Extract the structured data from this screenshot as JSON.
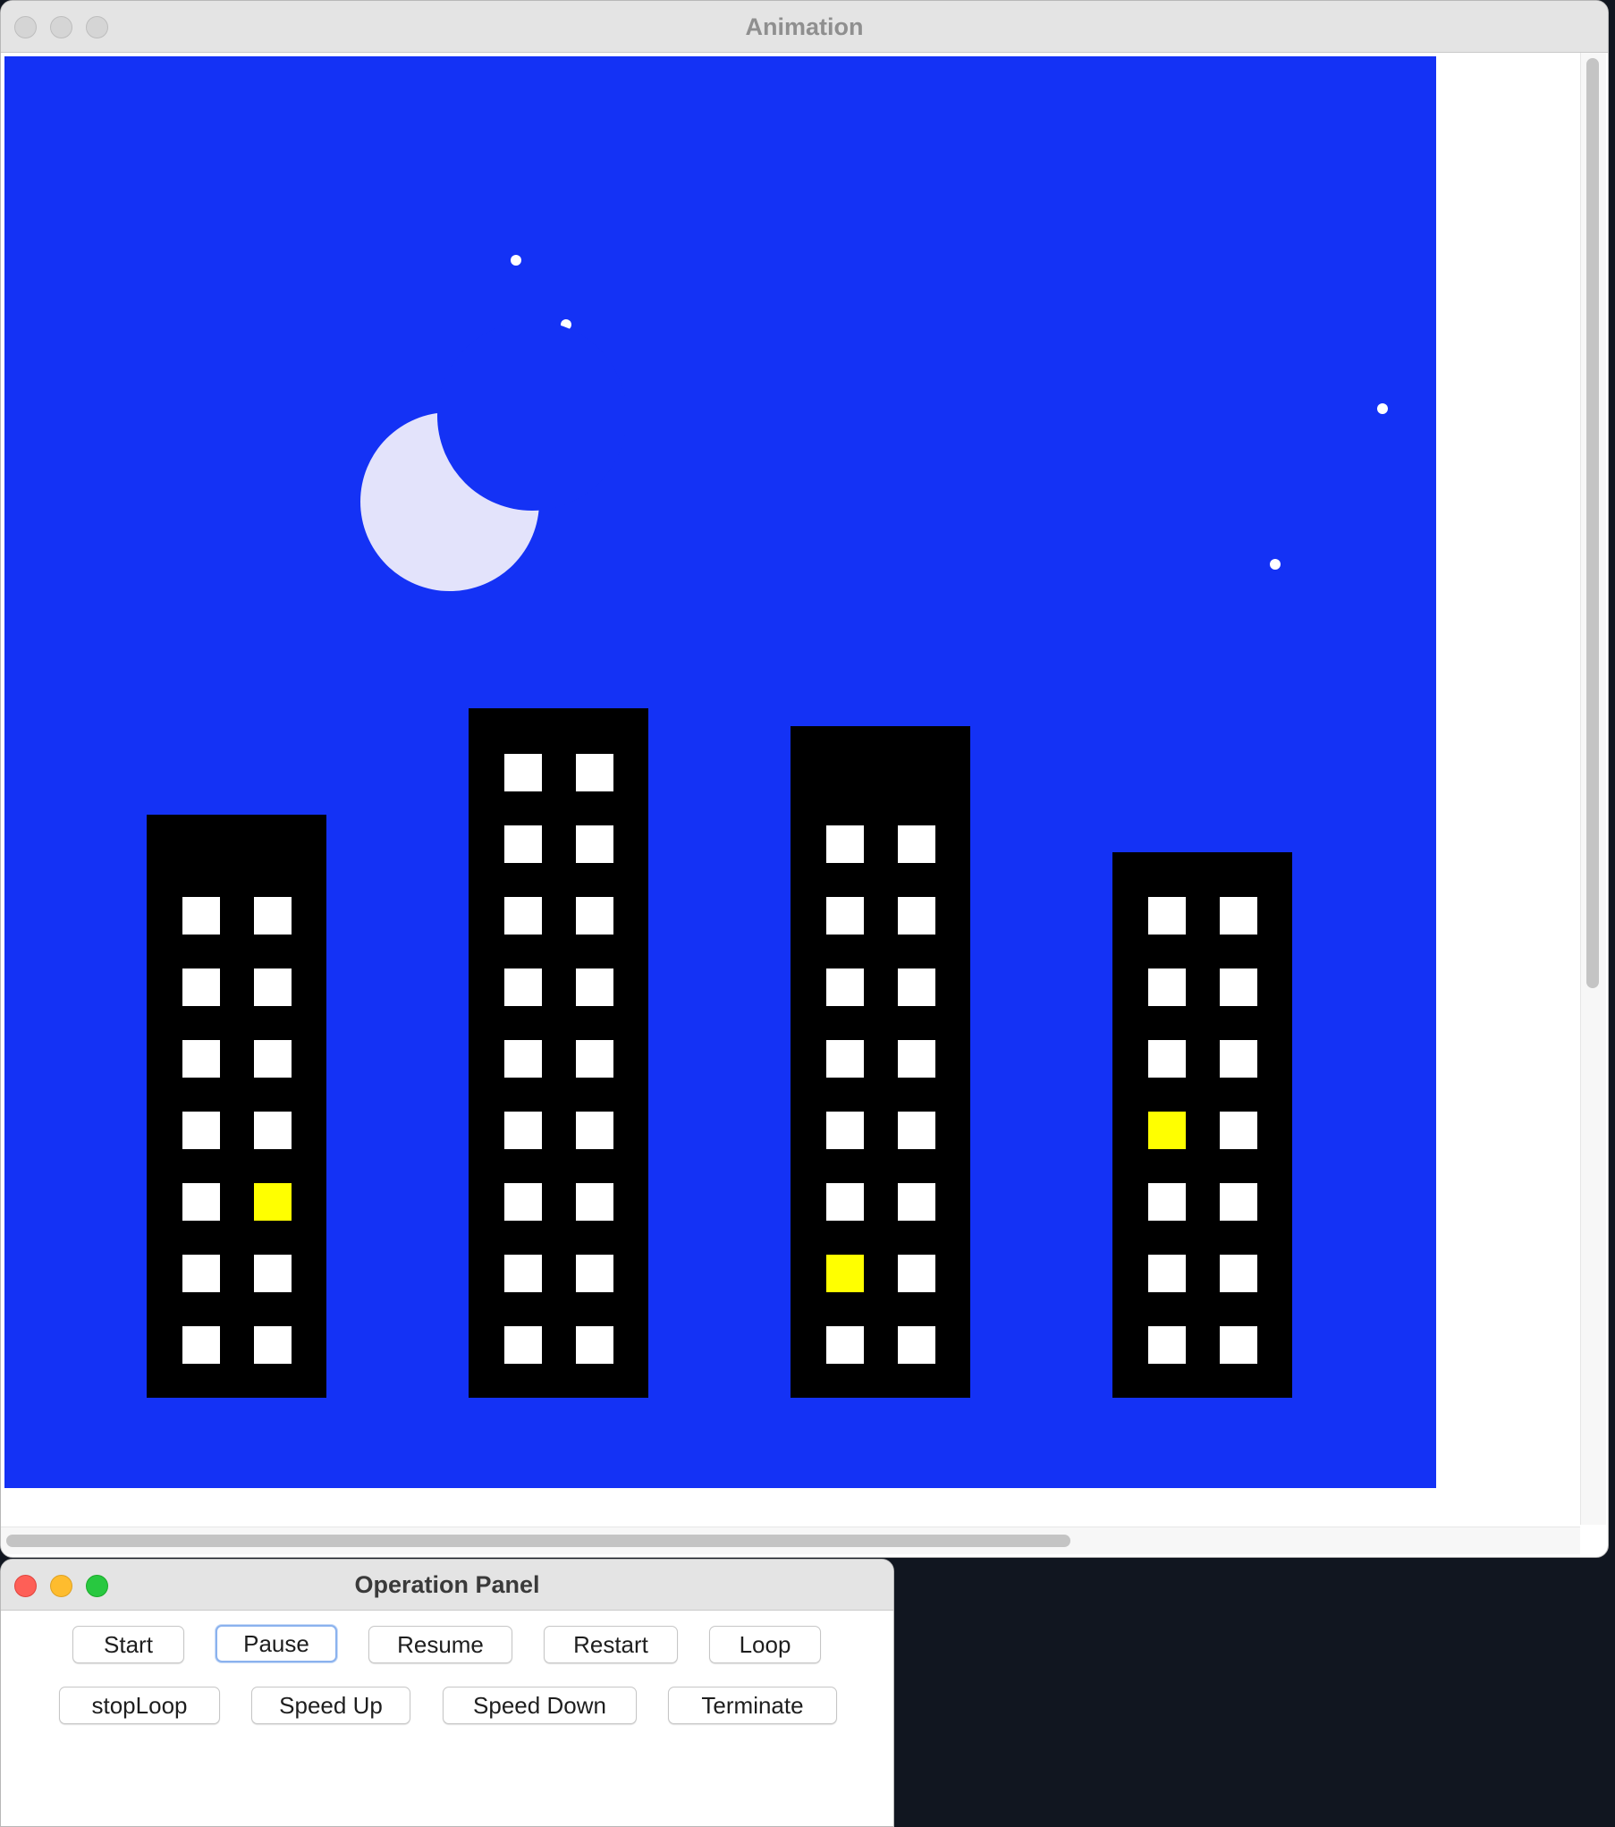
{
  "animation_window": {
    "title": "Animation",
    "scene": {
      "sky_color": "#1432f5",
      "moon_color": "#e3e3fb",
      "building_color": "#000000",
      "window_lit_color": "#ffffff",
      "window_highlight_color": "#ffff00",
      "star_color": "#ffffff",
      "buildings": [
        {
          "name": "building-1",
          "window_rows": 7,
          "highlight": {
            "row": 5,
            "col": 2
          }
        },
        {
          "name": "building-2",
          "window_rows": 9,
          "highlight": null
        },
        {
          "name": "building-3",
          "window_rows": 8,
          "highlight": {
            "row": 7,
            "col": 1
          }
        },
        {
          "name": "building-4",
          "window_rows": 7,
          "highlight": {
            "row": 4,
            "col": 1
          }
        }
      ],
      "star_count": 4
    }
  },
  "operation_panel": {
    "title": "Operation Panel",
    "buttons": {
      "start": "Start",
      "pause": "Pause",
      "resume": "Resume",
      "restart": "Restart",
      "loop": "Loop",
      "stop_loop": "stopLoop",
      "speed_up": "Speed Up",
      "speed_down": "Speed Down",
      "terminate": "Terminate"
    },
    "focused_button": "Pause"
  }
}
